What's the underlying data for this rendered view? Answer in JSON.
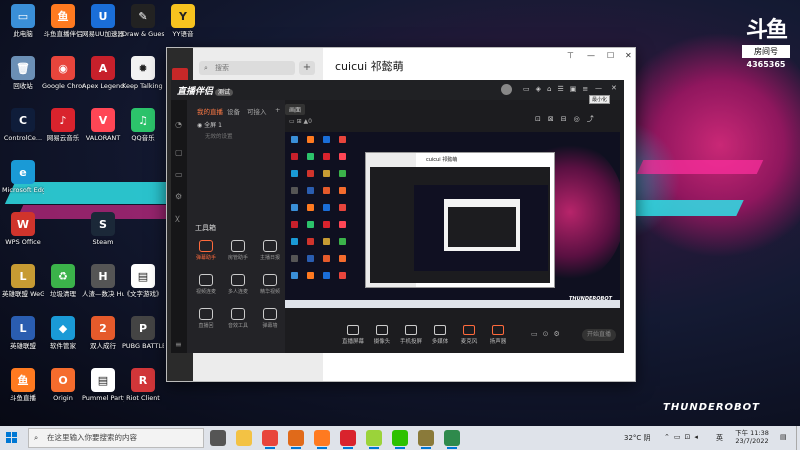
{
  "desktop_icons": [
    {
      "label": "此电脑",
      "color": "#3a8fd8",
      "glyph": "▭"
    },
    {
      "label": "斗鱼直播伴侣",
      "color": "#ff7a20",
      "glyph": "鱼"
    },
    {
      "label": "网易UU加速器",
      "color": "#1a6ed8",
      "glyph": "U"
    },
    {
      "label": "Draw & Guess",
      "color": "#222222",
      "glyph": "✎"
    },
    {
      "label": "YY语音",
      "color": "#f7c31f",
      "glyph": "Y"
    },
    {
      "label": "回收站",
      "color": "#6b8fb5",
      "glyph": "🗑"
    },
    {
      "label": "Google Chrome",
      "color": "#e8453c",
      "glyph": "◉"
    },
    {
      "label": "Apex Legends",
      "color": "#c7202b",
      "glyph": "A"
    },
    {
      "label": "Keep Talking a...",
      "color": "#f2f2f2",
      "glyph": "✹"
    },
    {
      "label": "ControlCe...",
      "color": "#0f1d3a",
      "glyph": "C"
    },
    {
      "label": "网易云音乐",
      "color": "#d9232d",
      "glyph": "♪"
    },
    {
      "label": "VALORANT",
      "color": "#ff4655",
      "glyph": "V"
    },
    {
      "label": "QQ音乐",
      "color": "#2cc36b",
      "glyph": "♫"
    },
    {
      "label": "Microsoft Edge",
      "color": "#1a9ad6",
      "glyph": "e"
    },
    {
      "label": "WPS Office",
      "color": "#d0342c",
      "glyph": "W"
    },
    {
      "label": "Steam",
      "color": "#1b2838",
      "glyph": "S"
    },
    {
      "label": "英雄联盟 WeGame版",
      "color": "#c79b33",
      "glyph": "L"
    },
    {
      "label": "垃圾清理",
      "color": "#3bb34a",
      "glyph": "♻"
    },
    {
      "label": "人渣—数决 Human Fa...",
      "color": "#555555",
      "glyph": "H"
    },
    {
      "label": "《文字游戏》",
      "color": "#ffffff",
      "glyph": "▤"
    },
    {
      "label": "英雄联盟",
      "color": "#2a5db0",
      "glyph": "L"
    },
    {
      "label": "软件管家",
      "color": "#1a9ad6",
      "glyph": "◆"
    },
    {
      "label": "双人成行",
      "color": "#e55a2b",
      "glyph": "2"
    },
    {
      "label": "PUBG BATTLEGR...",
      "color": "#444444",
      "glyph": "P"
    },
    {
      "label": "斗鱼直播",
      "color": "#ff7a20",
      "glyph": "鱼"
    },
    {
      "label": "Origin",
      "color": "#f56c2d",
      "glyph": "O"
    },
    {
      "label": "Pummel Party",
      "color": "#ffffff",
      "glyph": "▤"
    },
    {
      "label": "Riot Client",
      "color": "#d13639",
      "glyph": "R"
    }
  ],
  "wallpaper": {
    "logo_text": "斗鱼",
    "room_label": "房间号",
    "room_number": "4365365",
    "brand": "THUNDEROBOT"
  },
  "chat_window": {
    "search_placeholder": "搜索",
    "add_label": "+",
    "title": "cuicui 祁懿萌"
  },
  "app": {
    "logo": "直播伴侣",
    "version_badge": "测试",
    "tabs": [
      "我的直播",
      "设备",
      "可接入"
    ],
    "scene": "全屏 1",
    "scene_sub": "无效的设置",
    "preview_label": "画面",
    "toolbox_title": "工具箱",
    "tools": [
      "弹幕助手",
      "房管助手",
      "主播日报",
      "视频连麦",
      "多人连麦",
      "精华视频",
      "直播回",
      "音效工具",
      "弹幕墙"
    ],
    "bottom_buttons": [
      "直播屏幕",
      "摄像头",
      "手机投屏",
      "多媒体",
      "麦克风",
      "扬声器"
    ],
    "start_button": "开始直播",
    "tooltip": "最小化"
  },
  "taskbar": {
    "search_placeholder": "在这里输入你要搜索的内容",
    "weather": "32°C 阴",
    "time": "下午 11:38",
    "date": "23/7/2022",
    "ime": "英",
    "apps": [
      {
        "name": "task-view",
        "color": "#555555"
      },
      {
        "name": "file-explorer",
        "color": "#f3c244"
      },
      {
        "name": "chrome",
        "color": "#e8453c"
      },
      {
        "name": "app-g",
        "color": "#e06a1a"
      },
      {
        "name": "douyu",
        "color": "#ff7a20"
      },
      {
        "name": "netease-music",
        "color": "#d9232d"
      },
      {
        "name": "app-green",
        "color": "#9bd33a"
      },
      {
        "name": "wechat",
        "color": "#2dc100"
      },
      {
        "name": "app-tent",
        "color": "#8a7a3a"
      },
      {
        "name": "app-pin",
        "color": "#2f8a4c"
      }
    ]
  }
}
